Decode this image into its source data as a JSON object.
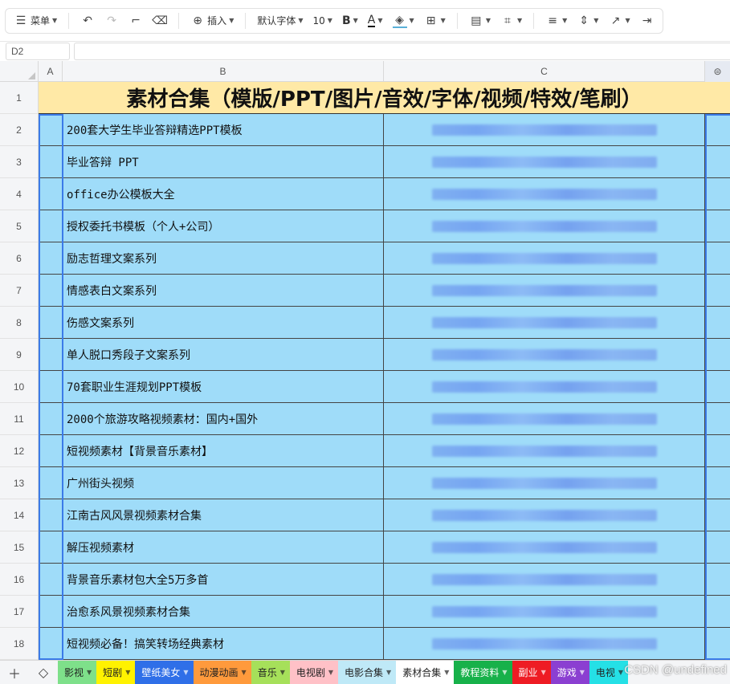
{
  "toolbar": {
    "menu_label": "菜单",
    "insert_label": "插入",
    "font_name": "默认字体",
    "font_size": "10",
    "bold_label": "B",
    "font_color_label": "A"
  },
  "name_box": "D2",
  "columns": [
    "A",
    "B",
    "C"
  ],
  "title": "素材合集（模版/PPT/图片/音效/字体/视频/特效/笔刷）",
  "rows": [
    {
      "num": "2",
      "name": "200套大学生毕业答辩精选PPT模板"
    },
    {
      "num": "3",
      "name": "毕业答辩 PPT"
    },
    {
      "num": "4",
      "name": "office办公模板大全"
    },
    {
      "num": "5",
      "name": "授权委托书模板（个人+公司）"
    },
    {
      "num": "6",
      "name": "励志哲理文案系列"
    },
    {
      "num": "7",
      "name": "情感表白文案系列"
    },
    {
      "num": "8",
      "name": "伤感文案系列"
    },
    {
      "num": "9",
      "name": "单人脱口秀段子文案系列"
    },
    {
      "num": "10",
      "name": "70套职业生涯规划PPT模板"
    },
    {
      "num": "11",
      "name": "2000个旅游攻略视频素材：国内+国外"
    },
    {
      "num": "12",
      "name": "短视频素材【背景音乐素材】"
    },
    {
      "num": "13",
      "name": "广州街头视频"
    },
    {
      "num": "14",
      "name": "江南古风风景视频素材合集"
    },
    {
      "num": "15",
      "name": "解压视频素材"
    },
    {
      "num": "16",
      "name": "背景音乐素材包大全5万多首"
    },
    {
      "num": "17",
      "name": "治愈系风景视频素材合集"
    },
    {
      "num": "18",
      "name": "短视频必备！搞笑转场经典素材"
    }
  ],
  "tabs": [
    {
      "label": "影视",
      "bg": "#7ee08a",
      "color": "#222"
    },
    {
      "label": "短剧",
      "bg": "#fff200",
      "color": "#222"
    },
    {
      "label": "壁纸美女",
      "bg": "#2f6fe8",
      "color": "#ffffff"
    },
    {
      "label": "动漫动画",
      "bg": "#ff9a3c",
      "color": "#222"
    },
    {
      "label": "音乐",
      "bg": "#a6e05a",
      "color": "#222"
    },
    {
      "label": "电视剧",
      "bg": "#ffc1c7",
      "color": "#222"
    },
    {
      "label": "电影合集",
      "bg": "#bfe9f7",
      "color": "#222"
    },
    {
      "label": "素材合集",
      "bg": "#ffffff",
      "color": "#222"
    },
    {
      "label": "教程资料",
      "bg": "#17b14a",
      "color": "#ffffff"
    },
    {
      "label": "副业",
      "bg": "#ee1c24",
      "color": "#ffffff"
    },
    {
      "label": "游戏",
      "bg": "#8b3fd1",
      "color": "#ffffff"
    },
    {
      "label": "电视",
      "bg": "#25e0e6",
      "color": "#222"
    }
  ],
  "watermark": "CSDN @undefined",
  "colors": {
    "title_bg": "#ffe9a6",
    "row_bg": "#9fdcf9",
    "selection": "#3b7be8"
  }
}
